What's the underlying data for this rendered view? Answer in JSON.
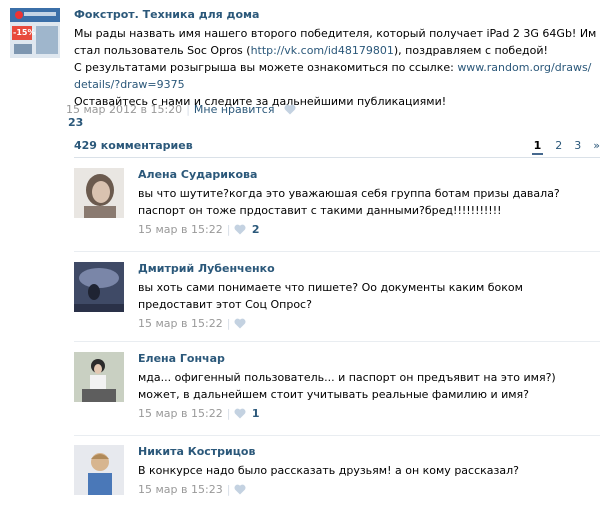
{
  "post": {
    "author": "Фокстрот. Техника для дома",
    "text_lines": [
      "Мы рады назвать имя нашего второго победителя, который получает iPad 2 3G 64Gb! Им",
      "стал пользователь Soc Opros (",
      "http://vk.com/id48179801",
      "), поздравляем с победой!",
      "С результатами розыгрыша вы можете ознакомиться по ссылке: ",
      "www.random.org/draws/",
      "details/?draw=9375",
      "Оставайтесь с нами и следите за дальнейшими публикациями!"
    ],
    "date": "15 мар 2012 в 15:20",
    "like_label": "Мне нравится",
    "like_count": "23",
    "avatar_badge": "-15%"
  },
  "comments_header": {
    "count_label": "429 комментариев",
    "pages": [
      "1",
      "2",
      "3",
      "»"
    ]
  },
  "comments": [
    {
      "author": "Алена Сударикова",
      "text": "вы что шутите?когда это уважаюшая себя группа ботам призы давала?паспорт он тоже прдоставит с такими данными?бред!!!!!!!!!!!",
      "date": "15 мар в 15:22",
      "likes": "2"
    },
    {
      "author": "Дмитрий Лубенченко",
      "text": "вы хоть сами понимаете что пишете? Оо документы каким боком предоставит этот Соц Опрос?",
      "date": "15 мар в 15:22",
      "likes": ""
    },
    {
      "author": "Елена Гончар",
      "text": "мда... офигенный пользователь... и паспорт он предъявит на это имя?) может, в дальнейшем стоит учитывать реальные фамилию и имя?",
      "date": "15 мар в 15:22",
      "likes": "1"
    },
    {
      "author": "Никита Кострицов",
      "text": "В конкурсе надо было рассказать друзьям! а он кому рассказал?",
      "date": "15 мар в 15:23",
      "likes": ""
    }
  ],
  "colors": {
    "link": "#2b587a",
    "meta": "#999999",
    "heart": "#c4d2e1"
  }
}
